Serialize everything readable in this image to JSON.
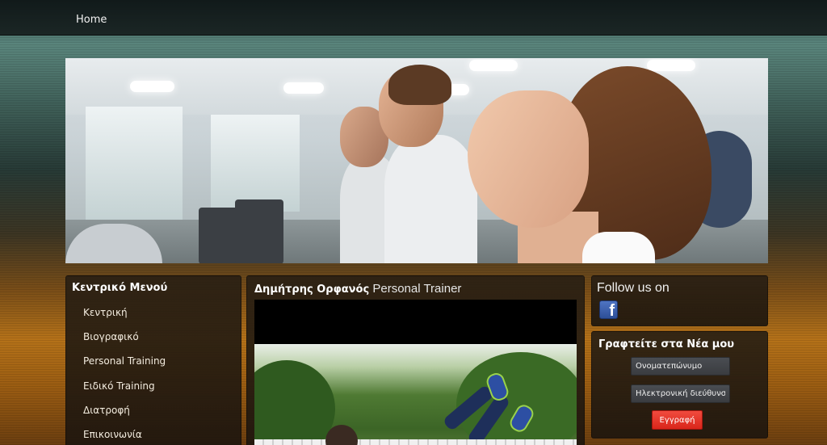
{
  "nav": {
    "home_label": "Home"
  },
  "left_menu": {
    "title": "Κεντρικό Μενού",
    "items": [
      {
        "label": "Κεντρική"
      },
      {
        "label": "Βιογραφικό"
      },
      {
        "label": "Personal Training"
      },
      {
        "label": "Ειδικό Training"
      },
      {
        "label": "Διατροφή"
      },
      {
        "label": "Επικοινωνία"
      }
    ]
  },
  "center": {
    "title_name": "Δημήτρης Ορφανός",
    "title_role": " Personal Trainer"
  },
  "follow": {
    "title": "Follow us on",
    "icon": "facebook-icon",
    "icon_glyph": "f"
  },
  "newsletter": {
    "title": "Γραφτείτε στα Νέα μου",
    "name_placeholder": "Ονοματεπώνυμο",
    "email_placeholder": "Ηλεκτρονική διεύθυνση",
    "submit_label": "Εγγραφή"
  },
  "colors": {
    "submit_button": "#e0342a",
    "facebook_blue": "#3b5998",
    "panel_bg": "#2a2014"
  }
}
